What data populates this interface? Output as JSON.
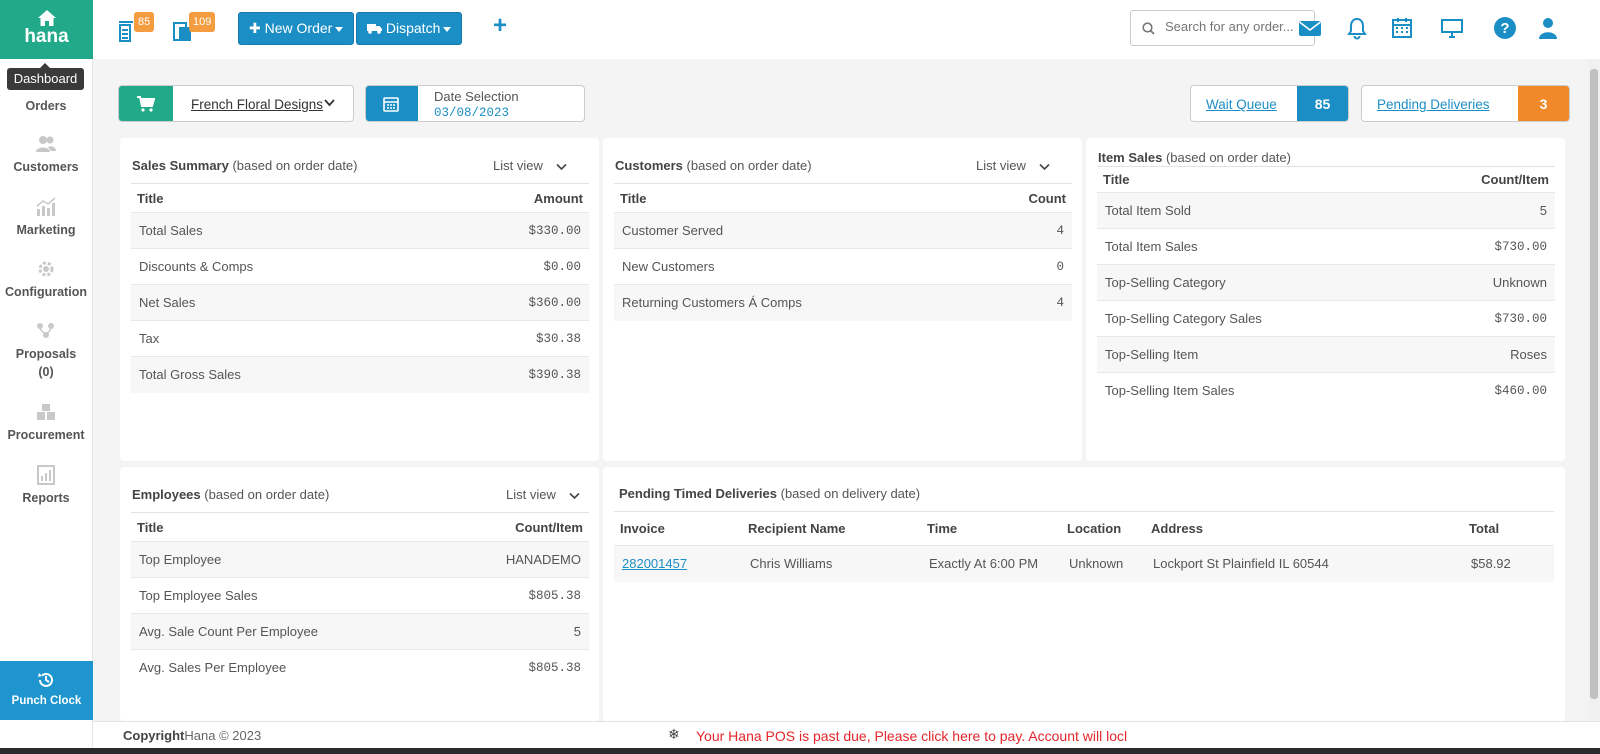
{
  "sidebar": {
    "brand": "hana",
    "tooltip": "Dashboard",
    "items": [
      {
        "label": "Orders"
      },
      {
        "label": "Customers"
      },
      {
        "label": "Marketing"
      },
      {
        "label": "Configuration"
      },
      {
        "label": "Proposals",
        "count": "(0)"
      },
      {
        "label": "Procurement"
      },
      {
        "label": "Reports"
      }
    ],
    "punch_clock": "Punch Clock"
  },
  "topbar": {
    "badge_orders": "85",
    "badge_copies": "109",
    "new_order": "New Order",
    "dispatch": "Dispatch",
    "search_placeholder": "Search for any order..."
  },
  "filters": {
    "store": "French Floral Designs",
    "date_label": "Date Selection",
    "date_value": "03/08/2023",
    "wait_queue_label": "Wait Queue",
    "wait_queue_count": "85",
    "pending_label": "Pending Deliveries",
    "pending_count": "3"
  },
  "sales_summary": {
    "title": "Sales Summary",
    "subtitle": "(based on order date)",
    "view": "List view",
    "col_title": "Title",
    "col_value": "Amount",
    "rows": [
      {
        "title": "Total Sales",
        "value": "$330.00"
      },
      {
        "title": "Discounts & Comps",
        "value": "$0.00"
      },
      {
        "title": "Net Sales",
        "value": "$360.00"
      },
      {
        "title": "Tax",
        "value": "$30.38"
      },
      {
        "title": "Total Gross Sales",
        "value": "$390.38"
      }
    ]
  },
  "customers": {
    "title": "Customers",
    "subtitle": "(based on order date)",
    "view": "List view",
    "col_title": "Title",
    "col_value": "Count",
    "rows": [
      {
        "title": "Customer Served",
        "value": "4"
      },
      {
        "title": "New Customers",
        "value": "0"
      },
      {
        "title": "Returning Customers Á Comps",
        "value": "4"
      }
    ]
  },
  "item_sales": {
    "title": "Item Sales",
    "subtitle": "(based on order date)",
    "col_title": "Title",
    "col_value": "Count/Item",
    "rows": [
      {
        "title": "Total Item Sold",
        "value": "5"
      },
      {
        "title": "Total Item Sales",
        "value": "$730.00"
      },
      {
        "title": "Top-Selling Category",
        "value": "Unknown"
      },
      {
        "title": "Top-Selling Category Sales",
        "value": "$730.00"
      },
      {
        "title": "Top-Selling Item",
        "value": "Roses"
      },
      {
        "title": "Top-Selling Item Sales",
        "value": "$460.00"
      }
    ]
  },
  "employees": {
    "title": "Employees",
    "subtitle": "(based on order date)",
    "view": "List view",
    "col_title": "Title",
    "col_value": "Count/Item",
    "rows": [
      {
        "title": "Top Employee",
        "value": "HANADEMO"
      },
      {
        "title": "Top Employee Sales",
        "value": "$805.38"
      },
      {
        "title": "Avg. Sale Count Per Employee",
        "value": "5"
      },
      {
        "title": "Avg. Sales Per Employee",
        "value": "$805.38"
      }
    ]
  },
  "deliveries": {
    "title": "Pending Timed Deliveries",
    "subtitle": "(based on delivery date)",
    "columns": [
      "Invoice",
      "Recipient Name",
      "Time",
      "Location",
      "Address",
      "Total"
    ],
    "rows": [
      {
        "invoice": "282001457",
        "recipient": "Chris Williams",
        "time": "Exactly At 6:00 PM",
        "location": "Unknown",
        "address": "Lockport St Plainfield IL 60544",
        "total": "$58.92"
      }
    ]
  },
  "footer": {
    "copyright_bold": "Copyright",
    "copyright_rest": "Hana © 2023",
    "warning": "Your Hana POS is past due, Please click here to pay. Account will locl"
  },
  "colors": {
    "brand_green": "#22a98a",
    "primary_blue": "#1c8ec6",
    "badge_orange": "#f39c40",
    "warning_red": "#e3262b"
  }
}
